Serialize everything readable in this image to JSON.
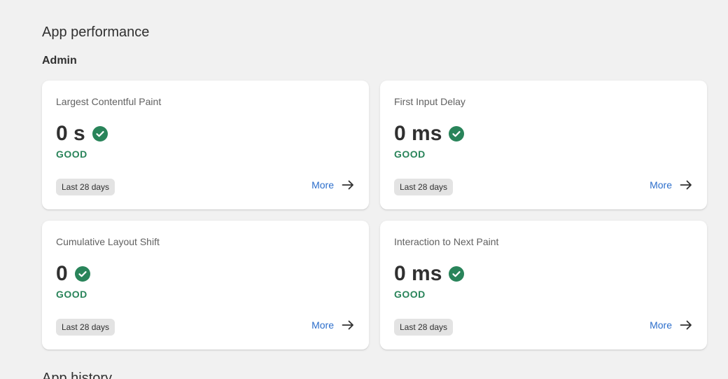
{
  "page": {
    "title": "App performance",
    "section": "Admin",
    "next_section_title": "App history"
  },
  "colors": {
    "good": "#29845a",
    "link": "#2c6ecb"
  },
  "cards": [
    {
      "title": "Largest Contentful Paint",
      "value": "0 s",
      "status": "GOOD",
      "period": "Last 28 days",
      "more": "More"
    },
    {
      "title": "First Input Delay",
      "value": "0 ms",
      "status": "GOOD",
      "period": "Last 28 days",
      "more": "More"
    },
    {
      "title": "Cumulative Layout Shift",
      "value": "0",
      "status": "GOOD",
      "period": "Last 28 days",
      "more": "More"
    },
    {
      "title": "Interaction to Next Paint",
      "value": "0 ms",
      "status": "GOOD",
      "period": "Last 28 days",
      "more": "More"
    }
  ],
  "icons": {
    "status": "check-circle-icon",
    "more": "arrow-right-icon"
  }
}
